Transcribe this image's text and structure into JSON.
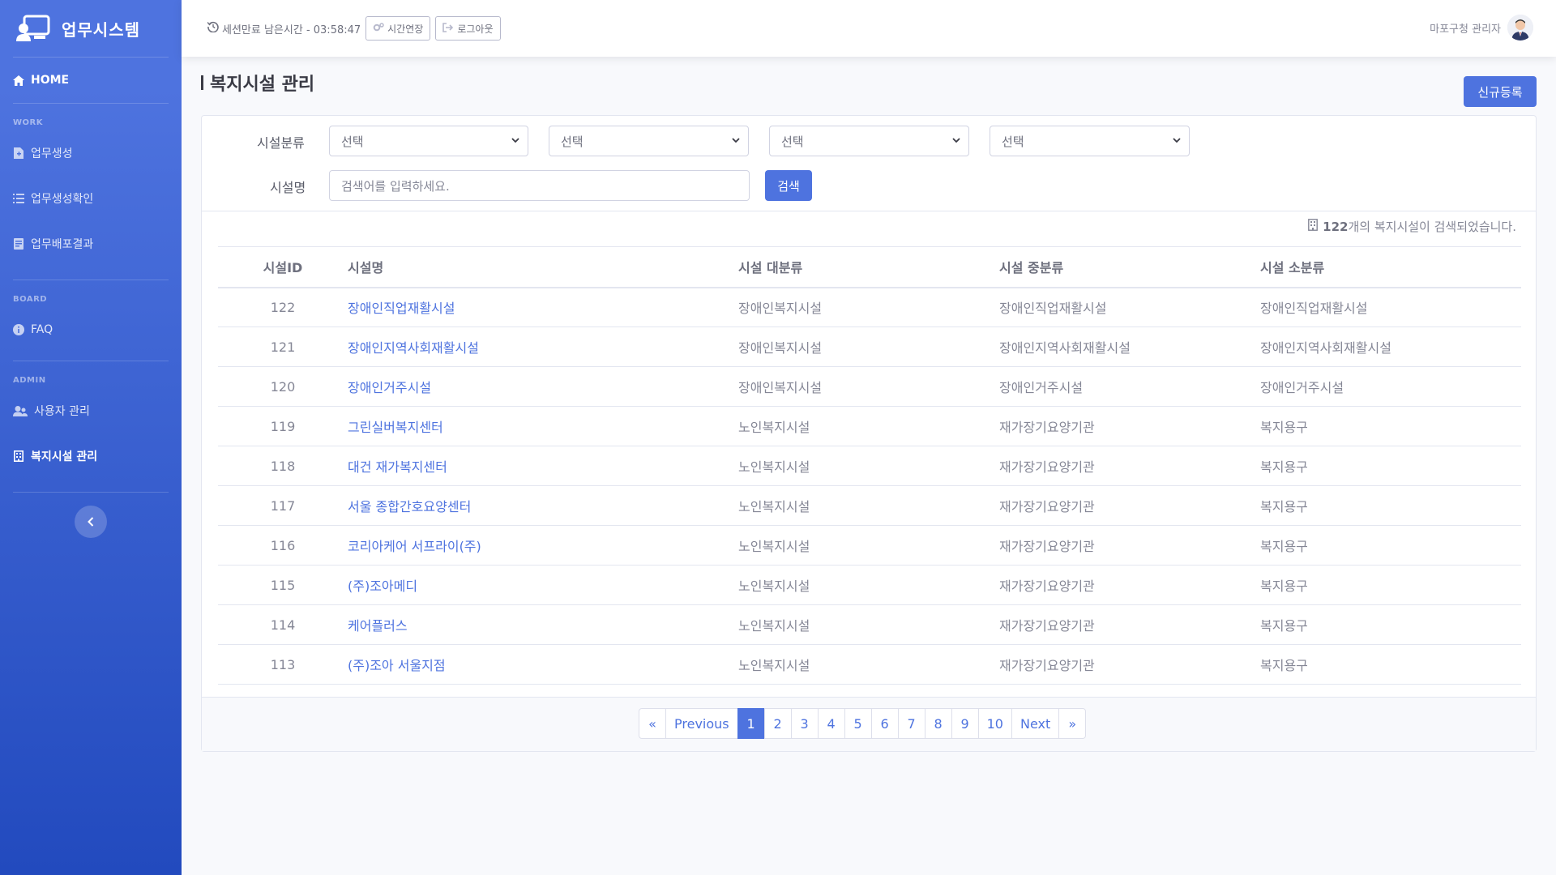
{
  "brand": {
    "name": "업무시스템"
  },
  "sidebar": {
    "home": "HOME",
    "sections": [
      {
        "head": "WORK",
        "items": [
          {
            "label": "업무생성",
            "icon": "file-plus-icon"
          },
          {
            "label": "업무생성확인",
            "icon": "list-icon"
          },
          {
            "label": "업무배포결과",
            "icon": "doc-icon"
          }
        ]
      },
      {
        "head": "BOARD",
        "items": [
          {
            "label": "FAQ",
            "icon": "info-circle-icon"
          }
        ]
      },
      {
        "head": "ADMIN",
        "items": [
          {
            "label": "사용자 관리",
            "icon": "users-icon"
          },
          {
            "label": "복지시설 관리",
            "icon": "building-icon",
            "active": true
          }
        ]
      }
    ]
  },
  "topbar": {
    "session_text": "세션만료 남은시간 - 03:58:47",
    "extend_label": "시간연장",
    "logout_label": "로그아웃",
    "user_name": "마포구청 관리자"
  },
  "page": {
    "title": "복지시설 관리",
    "new_button": "신규등록"
  },
  "filters": {
    "category_label": "시설분류",
    "selects": [
      "선택",
      "선택",
      "선택",
      "선택"
    ],
    "name_label": "시설명",
    "search_placeholder": "검색어를 입력하세요.",
    "search_button": "검색"
  },
  "result": {
    "count": "122",
    "suffix": "개의 복지시설이 검색되었습니다."
  },
  "table": {
    "headers": [
      "시설ID",
      "시설명",
      "시설 대분류",
      "시설 중분류",
      "시설 소분류"
    ],
    "rows": [
      [
        "122",
        "장애인직업재활시설",
        "장애인복지시설",
        "장애인직업재활시설",
        "장애인직업재활시설"
      ],
      [
        "121",
        "장애인지역사회재활시설",
        "장애인복지시설",
        "장애인지역사회재활시설",
        "장애인지역사회재활시설"
      ],
      [
        "120",
        "장애인거주시설",
        "장애인복지시설",
        "장애인거주시설",
        "장애인거주시설"
      ],
      [
        "119",
        "그린실버복지센터",
        "노인복지시설",
        "재가장기요양기관",
        "복지용구"
      ],
      [
        "118",
        "대건 재가복지센터",
        "노인복지시설",
        "재가장기요양기관",
        "복지용구"
      ],
      [
        "117",
        "서울 종합간호요양센터",
        "노인복지시설",
        "재가장기요양기관",
        "복지용구"
      ],
      [
        "116",
        "코리아케어 서프라이(주)",
        "노인복지시설",
        "재가장기요양기관",
        "복지용구"
      ],
      [
        "115",
        "(주)조아메디",
        "노인복지시설",
        "재가장기요양기관",
        "복지용구"
      ],
      [
        "114",
        "케어플러스",
        "노인복지시설",
        "재가장기요양기관",
        "복지용구"
      ],
      [
        "113",
        "(주)조아 서울지점",
        "노인복지시설",
        "재가장기요양기관",
        "복지용구"
      ]
    ]
  },
  "pagination": {
    "first": "«",
    "prev": "Previous",
    "pages": [
      "1",
      "2",
      "3",
      "4",
      "5",
      "6",
      "7",
      "8",
      "9",
      "10"
    ],
    "active_page": "1",
    "next": "Next",
    "last": "»"
  },
  "colors": {
    "primary": "#4e73df",
    "sidebar_start": "#4e73df",
    "sidebar_end": "#224abe"
  }
}
